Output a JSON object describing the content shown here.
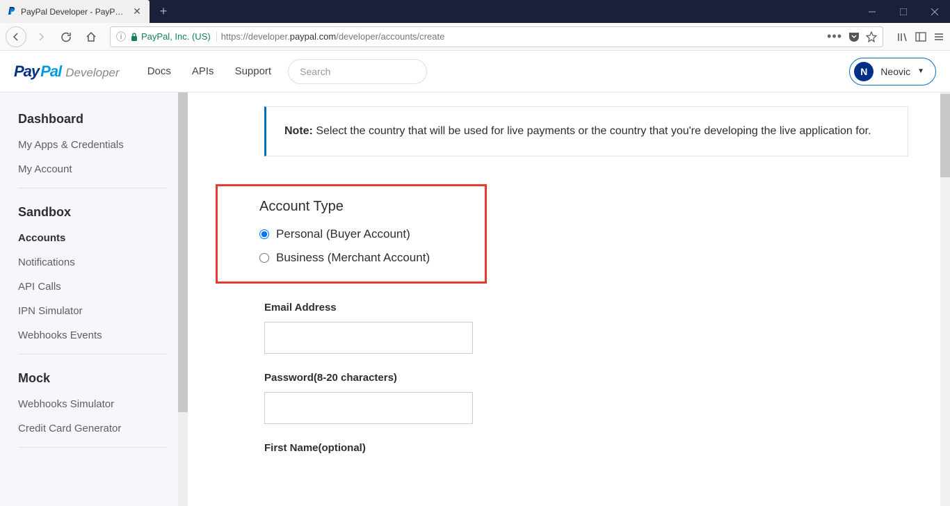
{
  "browser": {
    "tab_title": "PayPal Developer - PayPal Deve",
    "identity": "PayPal, Inc. (US)",
    "url_pre": "https://developer.",
    "url_host": "paypal.com",
    "url_path": "/developer/accounts/create"
  },
  "topbar": {
    "logo_pay": "Pay",
    "logo_pal": "Pal",
    "logo_dev": "Developer",
    "nav": {
      "docs": "Docs",
      "apis": "APIs",
      "support": "Support"
    },
    "search_placeholder": "Search",
    "user_initial": "N",
    "user_name": "Neovic"
  },
  "sidebar": {
    "dashboard": {
      "title": "Dashboard",
      "apps": "My Apps & Credentials",
      "account": "My Account"
    },
    "sandbox": {
      "title": "Sandbox",
      "accounts": "Accounts",
      "notifications": "Notifications",
      "api_calls": "API Calls",
      "ipn": "IPN Simulator",
      "webhooks": "Webhooks Events"
    },
    "mock": {
      "title": "Mock",
      "wh_sim": "Webhooks Simulator",
      "cc_gen": "Credit Card Generator"
    }
  },
  "note": {
    "label": "Note:",
    "text": " Select the country that will be used for live payments or the country that you're developing the live application for."
  },
  "form": {
    "account_type_title": "Account Type",
    "personal": "Personal (Buyer Account)",
    "business": "Business (Merchant Account)",
    "email_label": "Email Address",
    "password_label": "Password(8-20 characters)",
    "firstname_label": "First Name(optional)"
  }
}
